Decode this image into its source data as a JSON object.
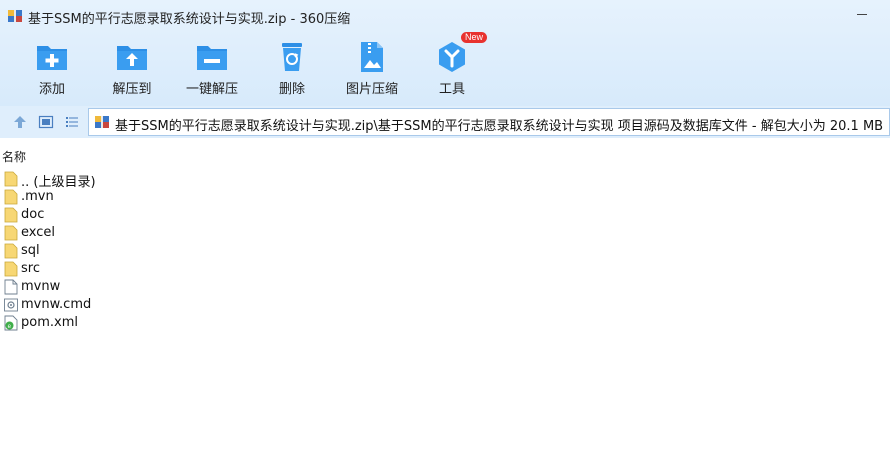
{
  "window": {
    "title": "基于SSM的平行志愿录取系统设计与实现.zip - 360压缩"
  },
  "toolbar": [
    {
      "label": "添加",
      "icon": "add-folder-icon"
    },
    {
      "label": "解压到",
      "icon": "extract-to-icon"
    },
    {
      "label": "一键解压",
      "icon": "one-click-extract-icon"
    },
    {
      "label": "删除",
      "icon": "recycle-bin-icon"
    },
    {
      "label": "图片压缩",
      "icon": "image-compress-icon"
    },
    {
      "label": "工具",
      "icon": "tools-icon",
      "badge": "New"
    }
  ],
  "address": {
    "path": "基于SSM的平行志愿录取系统设计与实现.zip\\基于SSM的平行志愿录取系统设计与实现 项目源码及数据库文件 - 解包大小为 20.1 MB"
  },
  "list": {
    "header_name": "名称",
    "items": [
      {
        "name": ".. (上级目录)",
        "type": "folder"
      },
      {
        "name": ".mvn",
        "type": "folder"
      },
      {
        "name": "doc",
        "type": "folder"
      },
      {
        "name": "excel",
        "type": "folder"
      },
      {
        "name": "sql",
        "type": "folder"
      },
      {
        "name": "src",
        "type": "folder"
      },
      {
        "name": "mvnw",
        "type": "file"
      },
      {
        "name": "mvnw.cmd",
        "type": "cmd"
      },
      {
        "name": "pom.xml",
        "type": "xml"
      }
    ]
  },
  "colors": {
    "accent_blue": "#2d8fe6",
    "folder_yellow": "#f7d774",
    "badge_red": "#e8322f"
  }
}
